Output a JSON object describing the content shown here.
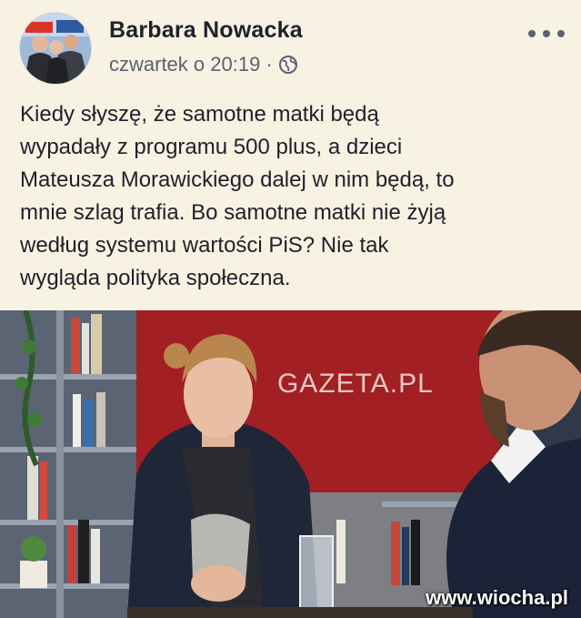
{
  "post": {
    "author": "Barbara Nowacka",
    "timestamp": "czwartek o 20:19",
    "separator": "·",
    "privacy_icon": "globe-icon",
    "more_icon": "more-options-icon",
    "text_lines": [
      "Kiedy słyszę, że samotne matki będą",
      "wypadały z programu 500 plus, a dzieci",
      "Mateusza Morawickiego dalej w nim będą, to",
      "mnie szlag trafia. Bo samotne matki nie żyją",
      "według systemu wartości PiS? Nie tak",
      "wygląda polityka społeczna."
    ]
  },
  "photo": {
    "studio_logo": "GAZETA.PL",
    "watermark": "www.wiocha.pl"
  },
  "colors": {
    "background": "#f8f2e3",
    "text": "#1d2129",
    "meta": "#5a6170",
    "studio_red": "#a21f24"
  }
}
